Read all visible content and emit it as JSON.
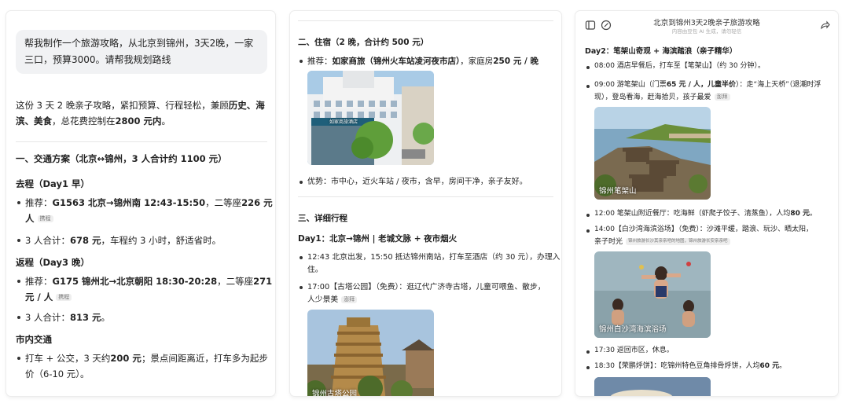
{
  "panel1": {
    "user_message": "帮我制作一个旅游攻略，从北京到锦州，3天2晚，一家三口，预算3000。请帮我规划路线",
    "intro": {
      "pre": "这份 3 天 2 晚亲子攻略，紧扣预算、行程轻松，兼顾",
      "bold1": "历史、海",
      "line2_bold": "滨、美食",
      "line2_mid": "，总花费控制在",
      "line2_bold2": "2800 元内",
      "line2_end": "。"
    },
    "section1_title": "一、交通方案（北京↔锦州，3 人合计约 1100 元）",
    "go_title": "去程（Day1 早）",
    "go_rec_label": "推荐：",
    "go_rec_bold": "G1563 北京→锦州南 12:43-15:50",
    "go_rec_mid": "，二等座",
    "go_rec_price": "226 元 /",
    "go_rec_line2": "人",
    "go_total_pre": "3 人合计：",
    "go_total_bold": "678 元",
    "go_total_end": "，车程约 3 小时，舒适省时。",
    "back_title": "返程（Day3 晚）",
    "back_rec_label": "推荐：",
    "back_rec_bold": "G175 锦州北→北京朝阳 18:30-20:28",
    "back_rec_mid": "，二等座",
    "back_rec_price": "271",
    "back_rec_line2": "元 / 人",
    "back_total_pre": "3 人合计：",
    "back_total_bold": "813 元",
    "back_total_end": "。",
    "city_title": "市内交通",
    "city_pre": "打车 + 公交，3 天约",
    "city_bold": "200 元",
    "city_end": "；景点间距离近，打车多为起步",
    "city_line2": "价（6-10 元）。",
    "source_tag": "携程"
  },
  "panel2": {
    "section2_title": "二、住宿（2 晚，合计约 500 元）",
    "hotel_label": "推荐：",
    "hotel_bold": "如家商旅（锦州火车站凌河夜市店）",
    "hotel_mid": "，家庭房",
    "hotel_price": "250 元 / 晚",
    "hotel_sign": "如家商旅酒店",
    "advantage": "优势：市中心，近火车站 / 夜市，含早，房间干净，亲子友好。",
    "section3_title": "三、详细行程",
    "day1_title": "Day1：北京→锦州 | 老城文脉 + 夜市烟火",
    "d1_item1_line1": "12:43 北京出发，15:50 抵达锦州南站，打车至酒店（约 30 元），办理入",
    "d1_item1_line2": "住。",
    "d1_item2_line1": "17:00【古塔公园】（免费）：逛辽代广济寺古塔，儿童可喂鱼、散步，",
    "d1_item2_line2": "人少景美",
    "d1_item2_tag": "澎拜",
    "photo_caption": "锦州古塔公园"
  },
  "panel3": {
    "header_title": "北京到锦州3天2晚亲子旅游攻略",
    "header_sub": "内容由豆包 AI 生成，请勿轻信",
    "day2_title": "Day2：笔架山奇观 + 海滨踏浪（亲子精华）",
    "d2_item1": "08:00 酒店早餐后，打车至【笔架山】（约 30 分钟）。",
    "d2_item2_pre": "09:00 游笔架山（门票",
    "d2_item2_bold": "65 元 / 人，儿童半价",
    "d2_item2_end": "）：走“海上天桥”（退潮时浮",
    "d2_item2_line2": "现），登岛看海，赶海拾贝，孩子最爱",
    "d2_item2_tag": "澎拜",
    "photo1_caption": "锦州笔架山",
    "d2_item3_pre": "12:00 笔架山附近餐厅：吃海鲜（虾爬子饺子、清蒸鱼），人均",
    "d2_item3_bold": "80 元",
    "d2_item3_end": "。",
    "d2_item4_line1": "14:00【白沙湾海滨浴场】（免费）：沙滩平缓，踏浪、玩沙、晒太阳，",
    "d2_item4_line2": "亲子时光",
    "d2_item4_tag": "锦州旅游长沙其亲亲吧的地图，锦州旅游长安亲亲吧",
    "photo2_caption": "锦州白沙湾海滨浴场",
    "d2_item5": "17:30 返回市区，休息。",
    "d2_item6_pre": "18:30【荣鹏烀饼】：吃锦州特色豆角排骨烀饼，人均",
    "d2_item6_bold": "60 元",
    "d2_item6_end": "。"
  }
}
